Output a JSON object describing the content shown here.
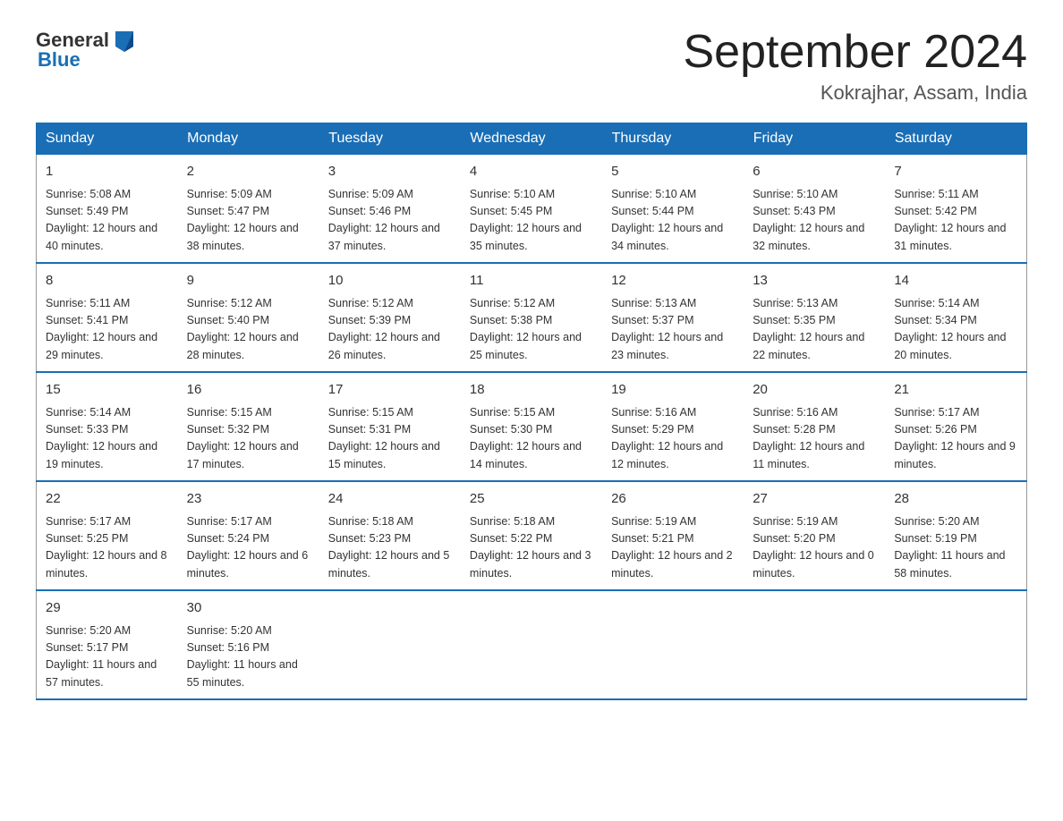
{
  "logo": {
    "text_general": "General",
    "text_blue": "Blue"
  },
  "calendar": {
    "title": "September 2024",
    "subtitle": "Kokrajhar, Assam, India",
    "days_of_week": [
      "Sunday",
      "Monday",
      "Tuesday",
      "Wednesday",
      "Thursday",
      "Friday",
      "Saturday"
    ],
    "weeks": [
      [
        {
          "date": "1",
          "sunrise": "5:08 AM",
          "sunset": "5:49 PM",
          "daylight": "12 hours and 40 minutes."
        },
        {
          "date": "2",
          "sunrise": "5:09 AM",
          "sunset": "5:47 PM",
          "daylight": "12 hours and 38 minutes."
        },
        {
          "date": "3",
          "sunrise": "5:09 AM",
          "sunset": "5:46 PM",
          "daylight": "12 hours and 37 minutes."
        },
        {
          "date": "4",
          "sunrise": "5:10 AM",
          "sunset": "5:45 PM",
          "daylight": "12 hours and 35 minutes."
        },
        {
          "date": "5",
          "sunrise": "5:10 AM",
          "sunset": "5:44 PM",
          "daylight": "12 hours and 34 minutes."
        },
        {
          "date": "6",
          "sunrise": "5:10 AM",
          "sunset": "5:43 PM",
          "daylight": "12 hours and 32 minutes."
        },
        {
          "date": "7",
          "sunrise": "5:11 AM",
          "sunset": "5:42 PM",
          "daylight": "12 hours and 31 minutes."
        }
      ],
      [
        {
          "date": "8",
          "sunrise": "5:11 AM",
          "sunset": "5:41 PM",
          "daylight": "12 hours and 29 minutes."
        },
        {
          "date": "9",
          "sunrise": "5:12 AM",
          "sunset": "5:40 PM",
          "daylight": "12 hours and 28 minutes."
        },
        {
          "date": "10",
          "sunrise": "5:12 AM",
          "sunset": "5:39 PM",
          "daylight": "12 hours and 26 minutes."
        },
        {
          "date": "11",
          "sunrise": "5:12 AM",
          "sunset": "5:38 PM",
          "daylight": "12 hours and 25 minutes."
        },
        {
          "date": "12",
          "sunrise": "5:13 AM",
          "sunset": "5:37 PM",
          "daylight": "12 hours and 23 minutes."
        },
        {
          "date": "13",
          "sunrise": "5:13 AM",
          "sunset": "5:35 PM",
          "daylight": "12 hours and 22 minutes."
        },
        {
          "date": "14",
          "sunrise": "5:14 AM",
          "sunset": "5:34 PM",
          "daylight": "12 hours and 20 minutes."
        }
      ],
      [
        {
          "date": "15",
          "sunrise": "5:14 AM",
          "sunset": "5:33 PM",
          "daylight": "12 hours and 19 minutes."
        },
        {
          "date": "16",
          "sunrise": "5:15 AM",
          "sunset": "5:32 PM",
          "daylight": "12 hours and 17 minutes."
        },
        {
          "date": "17",
          "sunrise": "5:15 AM",
          "sunset": "5:31 PM",
          "daylight": "12 hours and 15 minutes."
        },
        {
          "date": "18",
          "sunrise": "5:15 AM",
          "sunset": "5:30 PM",
          "daylight": "12 hours and 14 minutes."
        },
        {
          "date": "19",
          "sunrise": "5:16 AM",
          "sunset": "5:29 PM",
          "daylight": "12 hours and 12 minutes."
        },
        {
          "date": "20",
          "sunrise": "5:16 AM",
          "sunset": "5:28 PM",
          "daylight": "12 hours and 11 minutes."
        },
        {
          "date": "21",
          "sunrise": "5:17 AM",
          "sunset": "5:26 PM",
          "daylight": "12 hours and 9 minutes."
        }
      ],
      [
        {
          "date": "22",
          "sunrise": "5:17 AM",
          "sunset": "5:25 PM",
          "daylight": "12 hours and 8 minutes."
        },
        {
          "date": "23",
          "sunrise": "5:17 AM",
          "sunset": "5:24 PM",
          "daylight": "12 hours and 6 minutes."
        },
        {
          "date": "24",
          "sunrise": "5:18 AM",
          "sunset": "5:23 PM",
          "daylight": "12 hours and 5 minutes."
        },
        {
          "date": "25",
          "sunrise": "5:18 AM",
          "sunset": "5:22 PM",
          "daylight": "12 hours and 3 minutes."
        },
        {
          "date": "26",
          "sunrise": "5:19 AM",
          "sunset": "5:21 PM",
          "daylight": "12 hours and 2 minutes."
        },
        {
          "date": "27",
          "sunrise": "5:19 AM",
          "sunset": "5:20 PM",
          "daylight": "12 hours and 0 minutes."
        },
        {
          "date": "28",
          "sunrise": "5:20 AM",
          "sunset": "5:19 PM",
          "daylight": "11 hours and 58 minutes."
        }
      ],
      [
        {
          "date": "29",
          "sunrise": "5:20 AM",
          "sunset": "5:17 PM",
          "daylight": "11 hours and 57 minutes."
        },
        {
          "date": "30",
          "sunrise": "5:20 AM",
          "sunset": "5:16 PM",
          "daylight": "11 hours and 55 minutes."
        },
        null,
        null,
        null,
        null,
        null
      ]
    ]
  }
}
